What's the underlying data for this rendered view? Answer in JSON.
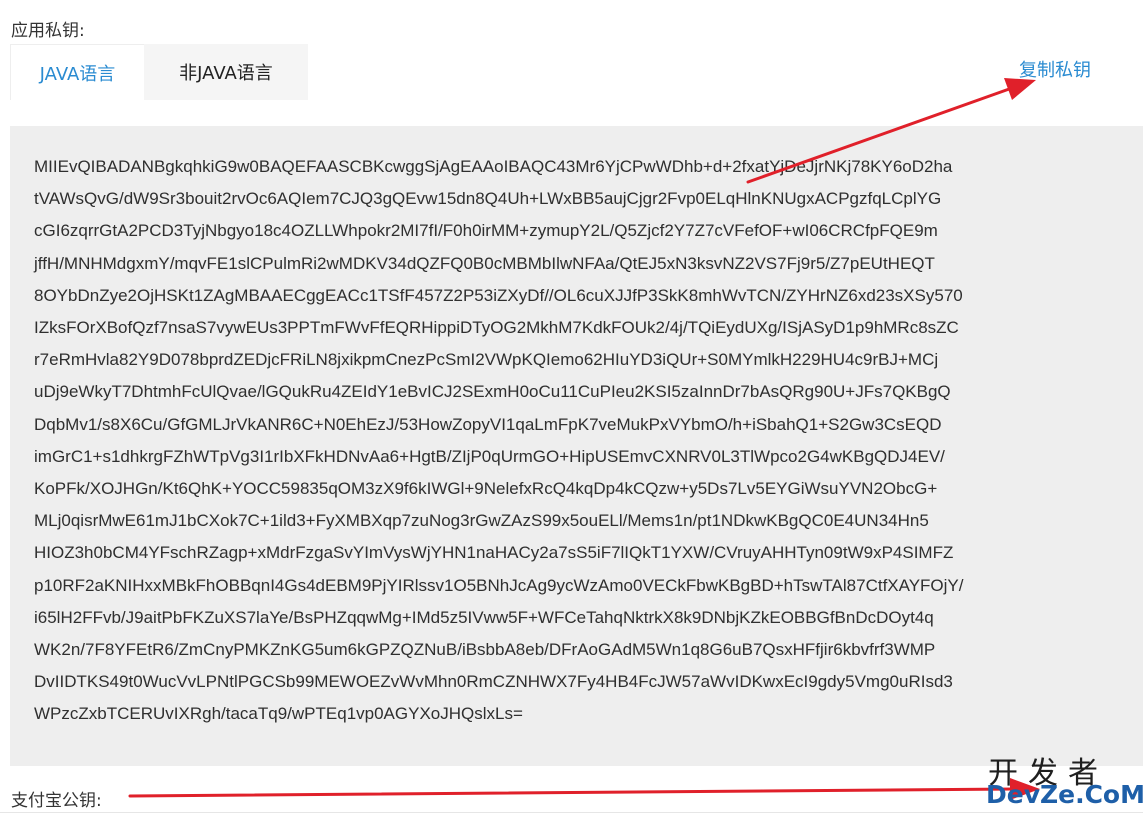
{
  "app_private_key_label": "应用私钥:",
  "tabs": [
    {
      "label": "JAVA语言",
      "active": true
    },
    {
      "label": "非JAVA语言",
      "active": false
    }
  ],
  "copy_private_key_label": "复制私钥",
  "private_key_lines": [
    "MIIEvQIBADANBgkqhkiG9w0BAQEFAASCBKcwggSjAgEAAoIBAQC43Mr6YjCPwWDhb+d+2fxatYjDeJjrNKj78KY6oD2ha",
    "tVAWsQvG/dW9Sr3bouit2rvOc6AQIem7CJQ3gQEvw15dn8Q4Uh+LWxBB5aujCjgr2Fvp0ELqHlnKNUgxACPgzfqLCplYG",
    "cGI6zqrrGtA2PCD3TyjNbgyo18c4OZLLWhpokr2MI7fI/F0h0irMM+zymupY2L/Q5Zjcf2Y7Z7cVFefOF+wI06CRCfpFQE9m",
    "jffH/MNHMdgxmY/mqvFE1slCPulmRi2wMDKV34dQZFQ0B0cMBMbIlwNFAa/QtEJ5xN3ksvNZ2VS7Fj9r5/Z7pEUtHEQT",
    "8OYbDnZye2OjHSKt1ZAgMBAAECggEACc1TSfF457Z2P53iZXyDf//OL6cuXJJfP3SkK8mhWvTCN/ZYHrNZ6xd23sXSy570",
    "IZksFOrXBofQzf7nsaS7vywEUs3PPTmFWvFfEQRHippiDTyOG2MkhM7KdkFOUk2/4j/TQiEydUXg/ISjASyD1p9hMRc8sZC",
    "r7eRmHvla82Y9D078bprdZEDjcFRiLN8jxikpmCnezPcSmI2VWpKQIemo62HIuYD3iQUr+S0MYmlkH229HU4c9rBJ+MCj",
    "uDj9eWkyT7DhtmhFcUlQvae/lGQukRu4ZEIdY1eBvICJ2SExmH0oCu11CuPIeu2KSI5zaInnDr7bAsQRg90U+JFs7QKBgQ",
    "DqbMv1/s8X6Cu/GfGMLJrVkANR6C+N0EhEzJ/53HowZopyVI1qaLmFpK7veMukPxVYbmO/h+iSbahQ1+S2Gw3CsEQD",
    "imGrC1+s1dhkrgFZhWTpVg3I1rIbXFkHDNvAa6+HgtB/ZIjP0qUrmGO+HipUSEmvCXNRV0L3TlWpco2G4wKBgQDJ4EV/",
    "KoPFk/XOJHGn/Kt6QhK+YOCC59835qOM3zX9f6kIWGl+9NelefxRcQ4kqDp4kCQzw+y5Ds7Lv5EYGiWsuYVN2ObcG+",
    "MLj0qisrMwE61mJ1bCXok7C+1ild3+FyXMBXqp7zuNog3rGwZAzS99x5ouELl/Mems1n/pt1NDkwKBgQC0E4UN34Hn5",
    "HIOZ3h0bCM4YFschRZagp+xMdrFzgaSvYImVysWjYHN1naHACy2a7sS5iF7lIQkT1YXW/CVruyAHHTyn09tW9xP4SIMFZ",
    "p10RF2aKNIHxxMBkFhOBBqnI4Gs4dEBM9PjYIRlssv1O5BNhJcAg9ycWzAmo0VECkFbwKBgBD+hTswTAl87CtfXAYFOjY/",
    "i65lH2FFvb/J9aitPbFKZuXS7laYe/BsPHZqqwMg+IMd5z5IVww5F+WFCeTahqNktrkX8k9DNbjKZkEOBBGfBnDcDOyt4q",
    "WK2n/7F8YFEtR6/ZmCnyPMKZnKG5um6kGPZQZNuB/iBsbbA8eb/DFrAoGAdM5Wn1q8G6uB7QsxHFfjir6kbvfrf3WMP",
    "DvIIDTKS49t0WucVvLPNtlPGCSb99MEWOEZvWvMhn0RmCZNHWX7Fy4HB4FcJW57aWvIDKwxEcI9gdy5Vmg0uRIsd3",
    "WPzcZxbTCERUvIXRgh/tacaTq9/wPTEq1vp0AGYXoJHQslxLs="
  ],
  "alipay_public_key_label": "支付宝公钥:",
  "watermark": {
    "top": "开发者",
    "bottom": "DevZe.CoM"
  },
  "annotation_color": "#e0202a"
}
